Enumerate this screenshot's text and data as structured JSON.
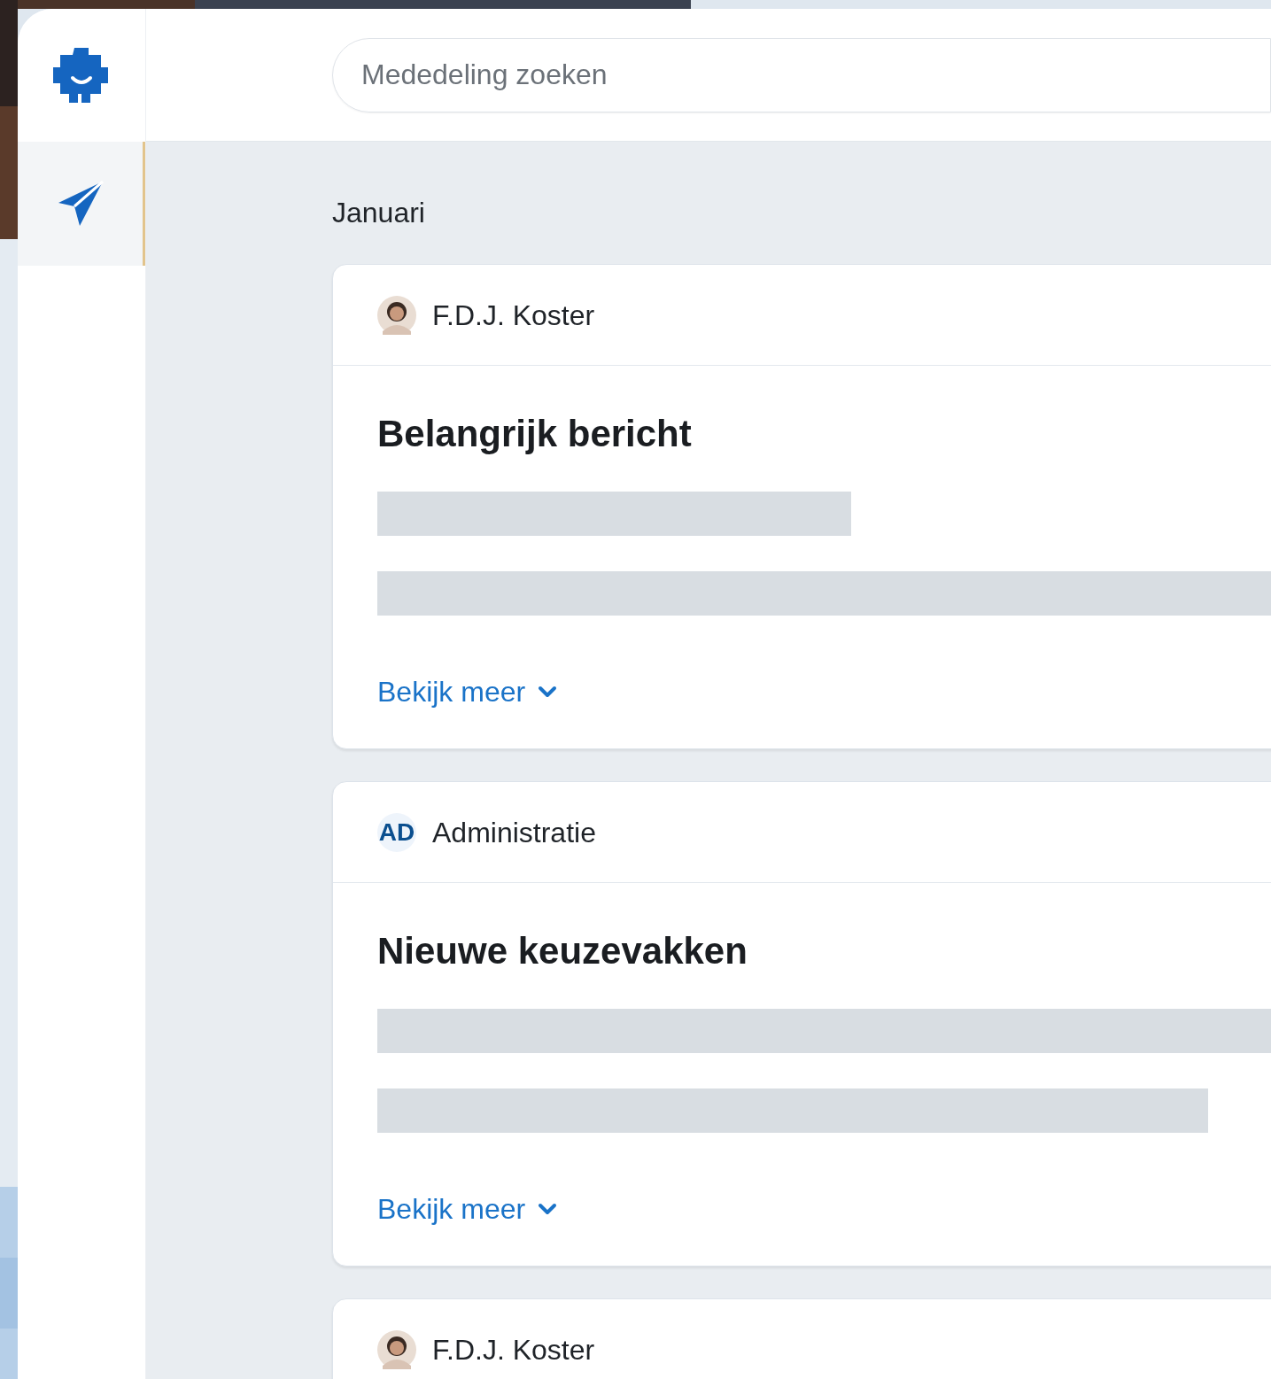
{
  "search": {
    "placeholder": "Mededeling zoeken"
  },
  "sidebar": {
    "items": [
      {
        "selected": true
      }
    ]
  },
  "month": "Januari",
  "messages": [
    {
      "author": {
        "name": "F.D.J. Koster"
      },
      "title": "Belangrijk bericht",
      "link": "Bekijk meer"
    },
    {
      "author": {
        "kind": "initials",
        "initials": "AD",
        "name": "Administratie"
      },
      "title": "Nieuwe keuzevakken",
      "link": "Bekijk meer"
    },
    {
      "author": {
        "name": "F.D.J. Koster"
      }
    }
  ]
}
